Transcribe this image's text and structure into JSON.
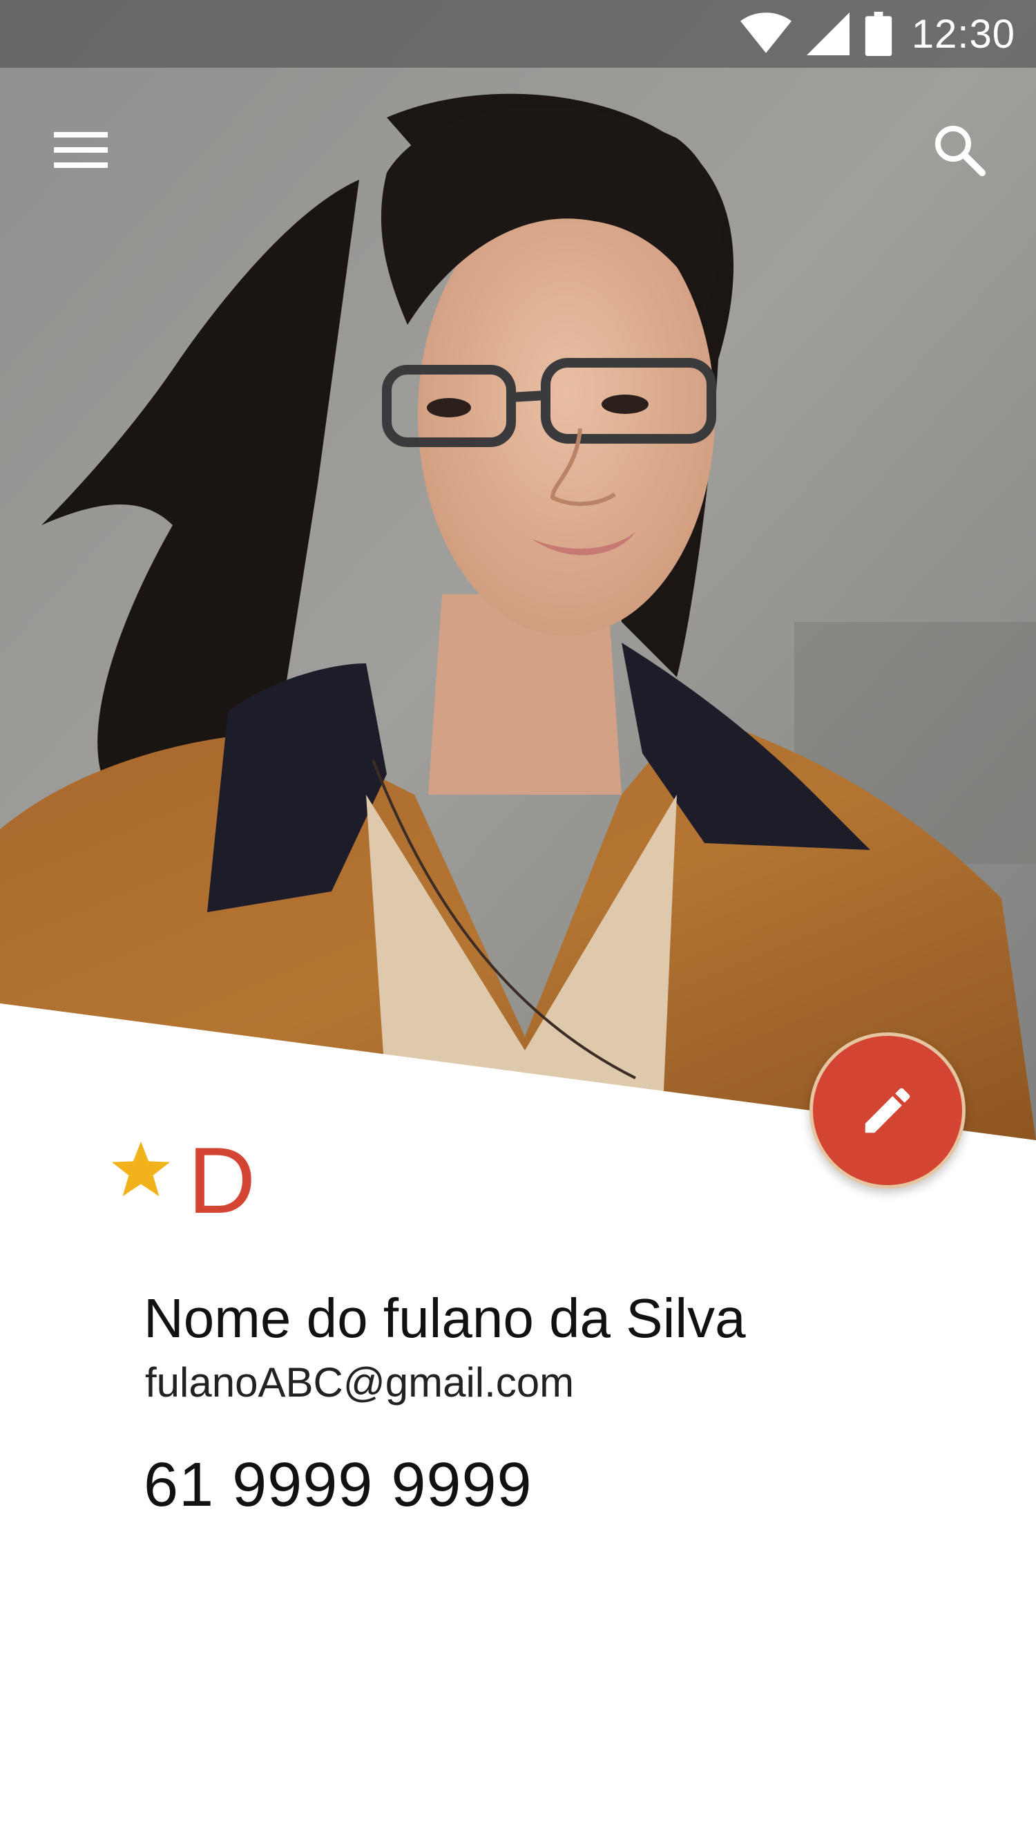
{
  "status_bar": {
    "time": "12:30",
    "icons": [
      "wifi-icon",
      "cell-signal-icon",
      "battery-icon"
    ]
  },
  "toolbar": {
    "menu_icon": "menu-icon",
    "search_icon": "search-icon"
  },
  "hero": {
    "description_icon": "contact-photo"
  },
  "fab": {
    "icon": "edit-pencil-icon",
    "color": "#d44433"
  },
  "contact": {
    "favorite_icon": "star-icon",
    "initial": "D",
    "name": "Nome do fulano da Silva",
    "email": "fulanoABC@gmail.com",
    "phone": "61 9999 9999"
  },
  "colors": {
    "accent": "#d44433",
    "star": "#f2b21b"
  }
}
